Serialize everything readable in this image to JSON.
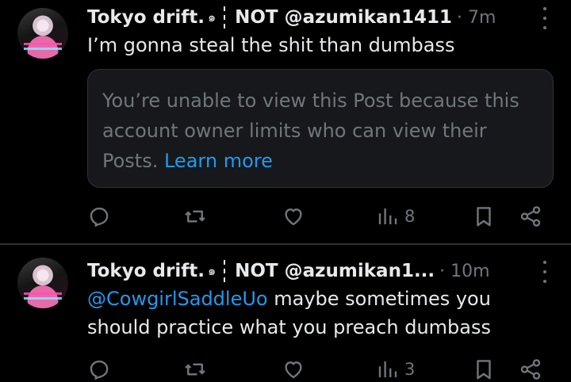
{
  "tweets": [
    {
      "display_name": "Tokyo drift.",
      "badge_glyph": "๑",
      "handle_text": "NOT @azumikan1411",
      "time": "· 7m",
      "text": "I’m gonna steal the shit than dumbass",
      "restricted_notice": {
        "text": "You’re unable to view this Post because this account owner limits who can view their Posts. ",
        "link": "Learn more"
      },
      "views": "8"
    },
    {
      "display_name": "Tokyo drift.",
      "badge_glyph": "๑",
      "handle_text": "NOT @azumikan1...",
      "time": "· 10m",
      "mention": "@CowgirlSaddleUo",
      "text": " maybe sometimes you should practice what you preach dumbass",
      "views": "3"
    }
  ],
  "icons": [
    "reply-icon",
    "retweet-icon",
    "like-icon",
    "views-icon",
    "bookmark-icon",
    "share-icon",
    "more-icon"
  ],
  "colors": {
    "background": "#000000",
    "text": "#e7e9ea",
    "muted": "#71767b",
    "accent": "#1d9bf0"
  }
}
